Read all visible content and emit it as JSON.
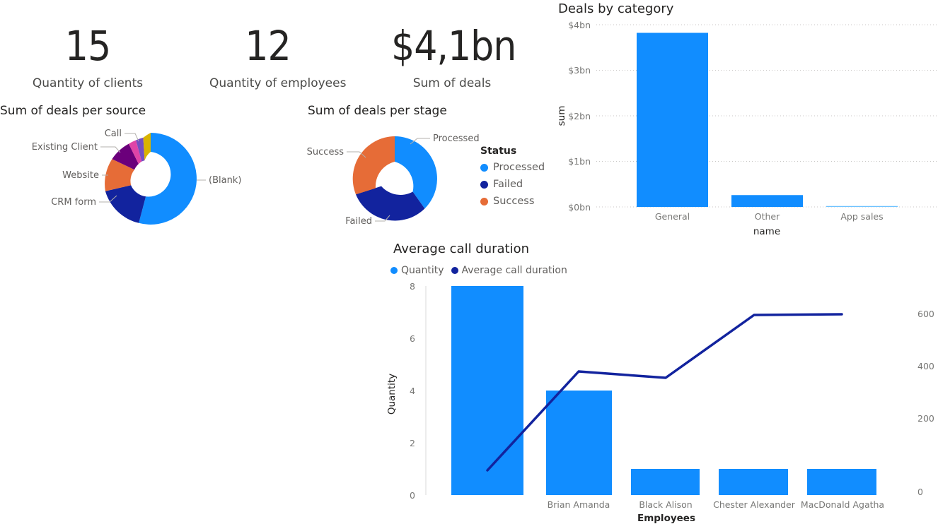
{
  "colors": {
    "blue": "#118DFF",
    "navy": "#12239E",
    "orange": "#E66C37",
    "purple": "#6B007B",
    "magenta": "#E044A7",
    "violet": "#744EC2",
    "gold": "#D9B300",
    "light_blue": "#6FC3FF",
    "text": "#252423",
    "muted": "#605E5C",
    "grid": "#C8C6C4"
  },
  "kpis": [
    {
      "value": "15",
      "label": "Quantity of clients"
    },
    {
      "value": "12",
      "label": "Quantity of employees"
    },
    {
      "value": "$4,1bn",
      "label": "Sum of deals"
    }
  ],
  "deals_per_source": {
    "title": "Sum of deals per source",
    "chart_data": {
      "type": "pie",
      "title": "Sum of deals per source",
      "labels": [
        "(Blank)",
        "CRM form",
        "Website",
        "Existing Client",
        "",
        "",
        "Call"
      ],
      "values": [
        54.2,
        16.7,
        11.1,
        9.7,
        2.8,
        2.8,
        2.7
      ],
      "colors": [
        "#118DFF",
        "#12239E",
        "#E66C37",
        "#6B007B",
        "#E044A7",
        "#744EC2",
        "#D9B300"
      ],
      "visible_labels": [
        "(Blank)",
        "CRM form",
        "Website",
        "Existing Client",
        "Call"
      ],
      "legend": "none",
      "hole": 0.58
    }
  },
  "deals_per_stage": {
    "title": "Sum of deals per stage",
    "legend_title": "Status",
    "chart_data": {
      "type": "pie",
      "title": "Sum of deals per stage",
      "labels": [
        "Processed",
        "Failed",
        "Success"
      ],
      "values": [
        37.5,
        31.9,
        30.6
      ],
      "colors": [
        "#118DFF",
        "#12239E",
        "#E66C37"
      ],
      "legend": "right",
      "hole": 0.6
    }
  },
  "deals_by_category": {
    "title": "Deals by category",
    "chart_data": {
      "type": "bar",
      "title": "Deals by category",
      "categories": [
        "General",
        "Other",
        "App sales"
      ],
      "values": [
        3.82,
        0.26,
        0.02
      ],
      "xlabel": "name",
      "ylabel": "sum",
      "ylim": [
        0,
        4
      ],
      "yticks": [
        0,
        1,
        2,
        3,
        4
      ],
      "ytick_labels": [
        "$0bn",
        "$1bn",
        "$2bn",
        "$3bn",
        "$4bn"
      ],
      "grid": true,
      "color": "#118DFF"
    }
  },
  "avg_call_duration": {
    "title": "Average call duration",
    "chart_data": {
      "type": "bar",
      "title": "Average call duration",
      "categories": [
        "",
        "Brian Amanda",
        "Black Alison",
        "Chester Alexander",
        "MacDonald Agatha"
      ],
      "xlabel": "Employees",
      "ylabel": "Quantity",
      "series": [
        {
          "name": "Quantity",
          "type": "bar",
          "axis": "left",
          "values": [
            8,
            4,
            1,
            1,
            1
          ],
          "color": "#118DFF"
        },
        {
          "name": "Average call duration",
          "type": "line",
          "axis": "right",
          "values": [
            95,
            465,
            440,
            570,
            572
          ],
          "color": "#12239E"
        }
      ],
      "ylim": [
        0,
        8
      ],
      "yticks": [
        0,
        2,
        4,
        6,
        8
      ],
      "ytick_labels": [
        "0",
        "2",
        "4",
        "6",
        "8"
      ],
      "y2lim": [
        0,
        800
      ],
      "y2ticks": [
        0,
        200,
        400,
        600
      ],
      "y2tick_labels": [
        "0",
        "200",
        "400",
        "600"
      ],
      "grid": false,
      "legend": "top"
    }
  }
}
